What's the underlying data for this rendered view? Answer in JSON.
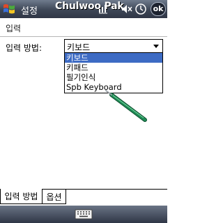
{
  "titlebar": {
    "start_icon": "windows-flag-icon",
    "app_title": "설정",
    "banner_text": "Chulwoo Pak",
    "tray_icons": [
      "connectivity-icon",
      "volume-icon",
      "clock-icon"
    ],
    "ok_label": "ok"
  },
  "header": {
    "title": "입력"
  },
  "input_method": {
    "label": "입력 방법:",
    "selected_value": "키보드",
    "options": [
      "키보드",
      "키패드",
      "필기인식",
      "Spb Keyboard"
    ],
    "selected_index": 0
  },
  "tabs": [
    {
      "label": "입력 방법",
      "active": true
    },
    {
      "label": "옵션",
      "active": false
    }
  ],
  "commandbar": {
    "sip_icon": "keyboard-icon"
  },
  "colors": {
    "titlebar": "#3d4656",
    "selection": "#3d6bc4",
    "stylus": "#1f8a55"
  }
}
